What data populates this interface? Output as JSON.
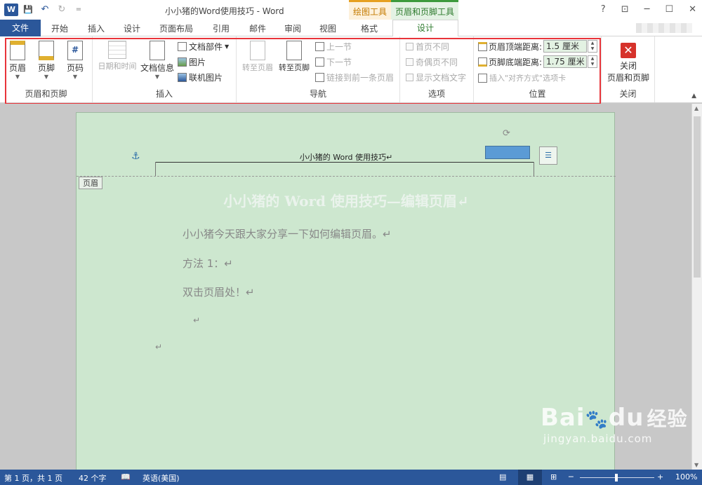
{
  "window": {
    "title": "小小猪的Word使用技巧 - Word",
    "buttons": [
      "?",
      "⊡",
      "─",
      "☐",
      "✕"
    ]
  },
  "qat": {
    "logo": "W",
    "save_icon": "💾",
    "undo_icon": "↶",
    "redo_icon": "↻",
    "more_icon": "="
  },
  "context_tabs": {
    "drawing_tools": "绘图工具",
    "header_footer_tools": "页眉和页脚工具"
  },
  "tabs": [
    "文件",
    "开始",
    "插入",
    "设计",
    "页面布局",
    "引用",
    "邮件",
    "审阅",
    "视图",
    "格式",
    "设计"
  ],
  "ribbon": {
    "header_footer": {
      "header": "页眉",
      "footer": "页脚",
      "page_number": "页码",
      "label": "页眉和页脚"
    },
    "insert": {
      "date_time": "日期和时间",
      "doc_info": "文档信息",
      "quick_parts": "文档部件",
      "picture": "图片",
      "online_picture": "联机图片",
      "label": "插入"
    },
    "navigation": {
      "goto_header": "转至页眉",
      "goto_footer": "转至页脚",
      "previous": "上一节",
      "next": "下一节",
      "link_previous": "链接到前一条页眉",
      "label": "导航"
    },
    "options": {
      "different_first": "首页不同",
      "odd_even": "奇偶页不同",
      "show_text": "显示文档文字",
      "label": "选项"
    },
    "position": {
      "header_top_label": "页眉顶端距离:",
      "header_top_value": "1.5 厘米",
      "footer_bottom_label": "页脚底端距离:",
      "footer_bottom_value": "1.75 厘米",
      "insert_align": "插入\"对齐方式\"选项卡",
      "label": "位置"
    },
    "close": {
      "button": "关闭\n页眉和页脚",
      "line1": "关闭",
      "line2": "页眉和页脚",
      "label": "关闭"
    }
  },
  "document": {
    "header_text": "小小猪的 Word 使用技巧↵",
    "header_tag": "页眉",
    "heading": "小小猪的 Word 使用技巧—编辑页眉↵",
    "paragraphs": [
      "小小猪今天跟大家分享一下如何编辑页眉。↵",
      "方法 1：↵",
      "双击页眉处！↵"
    ],
    "empty_marks": [
      "↵",
      "↵"
    ]
  },
  "status": {
    "page": "第 1 页，共 1 页",
    "words": "42 个字",
    "language": "英语(美国)",
    "zoom": "100%"
  },
  "watermark": {
    "brand": "Bai",
    "paw": "du",
    "cn": "经验",
    "url": "jingyan.baidu.com"
  },
  "colors": {
    "word_blue": "#2b579a",
    "page_green": "#cde7cf",
    "highlight_red": "#e8343a",
    "shape_blue": "#5b9bd5"
  }
}
